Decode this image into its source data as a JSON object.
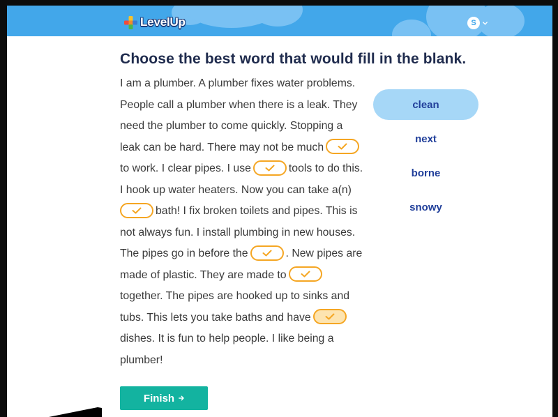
{
  "header": {
    "logo_text": "LevelUp",
    "avatar_initial": "S",
    "icons": {
      "logo": "levelup-logo-icon",
      "account_menu": "chevron-down-icon"
    }
  },
  "question": {
    "prompt": "Choose the best word that would fill in the blank."
  },
  "passage": {
    "fragments": [
      "I am a plumber. A plumber fixes water problems.",
      "People call a plumber when there is a leak. They",
      "need the plumber to come quickly. Stopping a",
      "leak can be hard. There may not be much",
      "to work. I clear pipes. I use",
      "tools to do this.",
      "I hook up water heaters. Now you can take a(n)",
      "bath! I fix broken toilets and pipes. This is",
      "not always fun. I install plumbing in new houses.",
      "The pipes go in before the",
      ". New pipes are",
      "made of plastic. They are made to",
      "together. The pipes are hooked up to sinks and",
      "tubs. This lets you take baths and have",
      "dishes. It is fun to help people. I like being a",
      "plumber!"
    ]
  },
  "blanks": [
    {
      "checked": true,
      "active": false,
      "icon": "checkmark-icon"
    },
    {
      "checked": true,
      "active": false,
      "icon": "checkmark-icon"
    },
    {
      "checked": true,
      "active": false,
      "icon": "checkmark-icon"
    },
    {
      "checked": true,
      "active": false,
      "icon": "checkmark-icon"
    },
    {
      "checked": true,
      "active": false,
      "icon": "checkmark-icon"
    },
    {
      "checked": true,
      "active": true,
      "icon": "checkmark-icon"
    }
  ],
  "choices": [
    {
      "label": "clean",
      "selected": true
    },
    {
      "label": "next",
      "selected": false
    },
    {
      "label": "borne",
      "selected": false
    },
    {
      "label": "snowy",
      "selected": false
    }
  ],
  "actions": {
    "finish_label": "Finish",
    "finish_icon": "arrow-right-icon"
  },
  "colors": {
    "header-bg": "#42a7ea",
    "cloud": "#79c1f3",
    "logo-outline": "#1b3c7a",
    "prompt-text": "#1f2b4d",
    "passage-text": "#3a3a3a",
    "blank-border": "#f5a623",
    "blank-active-fill": "#fde4b0",
    "choice-selected-bg": "#a6d7f7",
    "choice-text": "#213f9a",
    "finish-bg": "#13b3a0"
  }
}
